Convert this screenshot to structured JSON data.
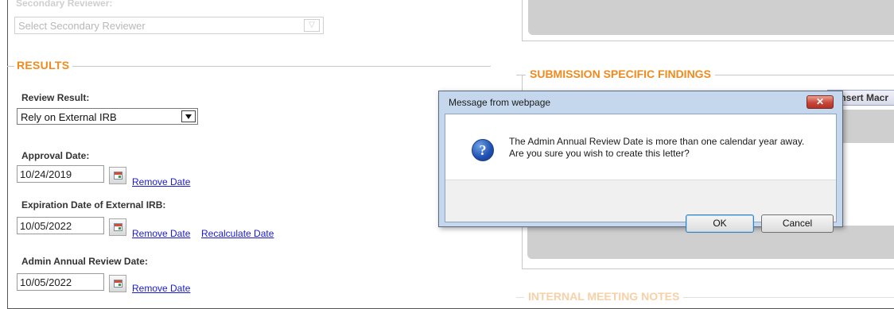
{
  "left": {
    "secondary_reviewer": {
      "label": "Secondary Reviewer:",
      "placeholder": "Select Secondary Reviewer"
    },
    "results": {
      "title": "RESULTS",
      "review_result": {
        "label": "Review Result:",
        "value": "Rely on External IRB"
      },
      "approval_date": {
        "label": "Approval Date:",
        "value": "10/24/2019",
        "remove_link": "Remove Date"
      },
      "expiration_date": {
        "label": "Expiration Date of External IRB:",
        "value": "10/05/2022",
        "remove_link": "Remove Date",
        "recalc_link": "Recalculate Date"
      },
      "admin_review_date": {
        "label": "Admin Annual Review Date:",
        "value": "10/05/2022",
        "remove_link": "Remove Date"
      }
    }
  },
  "right": {
    "submission_findings_title": "SUBMISSION SPECIFIC FINDINGS",
    "insert_macro_label": "Insert Macr",
    "internal_meeting_notes_title": "INTERNAL MEETING NOTES"
  },
  "dialog": {
    "title": "Message from webpage",
    "close_glyph": "✕",
    "icon": "help-icon",
    "message_line1": "The Admin Annual Review Date is more than one calendar year away.",
    "message_line2": "Are you sure you wish to create this letter?",
    "ok_label": "OK",
    "cancel_label": "Cancel"
  },
  "colors": {
    "section_title": "#f08a1c",
    "link": "#1a1ad0",
    "dialog_frame": "#c4d7ec",
    "close_button": "#c8473a"
  }
}
